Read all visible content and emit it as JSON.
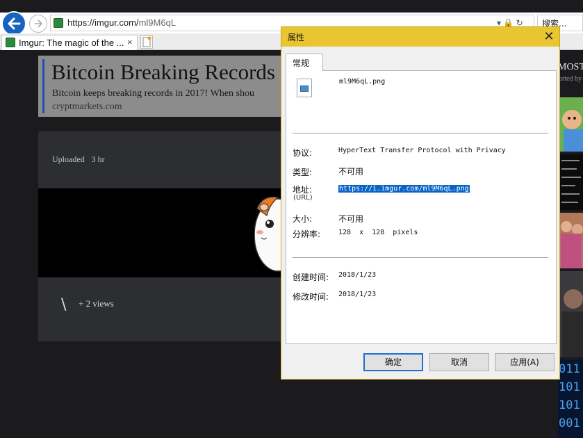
{
  "browser": {
    "url_host": "https://imgur.com/",
    "url_path": "ml9M6qL",
    "url_icons": "▾ 🔒 ↻",
    "search_placeholder": "搜索...",
    "tab_title": "Imgur: The magic of the ...",
    "tab_close": "×"
  },
  "page": {
    "headline": "Bitcoin Breaking Records",
    "headline_desc": "Bitcoin keeps breaking records in 2017! When shou",
    "headline_domain": "cryptmarkets.com",
    "uploaded_label": "Uploaded",
    "uploaded_age": "3 hr",
    "views": "+ 2 views",
    "slash": "\\"
  },
  "sidebar": {
    "most_label": "MOST",
    "sorted_label": "orted by",
    "binary_lines": [
      "011",
      "101",
      "101",
      "001"
    ]
  },
  "dialog": {
    "title": "属性",
    "close": "✕",
    "tab_general": "常规",
    "file_name": "ml9M6qL.png",
    "protocol_label": "协议:",
    "protocol_value": "HyperText Transfer Protocol with Privacy",
    "type_label": "类型:",
    "type_value": "不可用",
    "address_label": "地址:",
    "address_sub": "(URL)",
    "address_value": "https://i.imgur.com/ml9M6qL.png",
    "size_label": "大小:",
    "size_value": "不可用",
    "resolution_label": "分辨率:",
    "resolution_value": "128  x  128  pixels",
    "created_label": "创建时间:",
    "created_value": "2018/1/23",
    "modified_label": "修改时间:",
    "modified_value": "2018/1/23",
    "ok_button": "确定",
    "cancel_button": "取消",
    "apply_button": "应用(A)"
  },
  "colors": {
    "titlebar": "#e8c531",
    "selection": "#0a64c8",
    "back_button": "#1565c0",
    "headline_accent": "#1e4fb8"
  }
}
